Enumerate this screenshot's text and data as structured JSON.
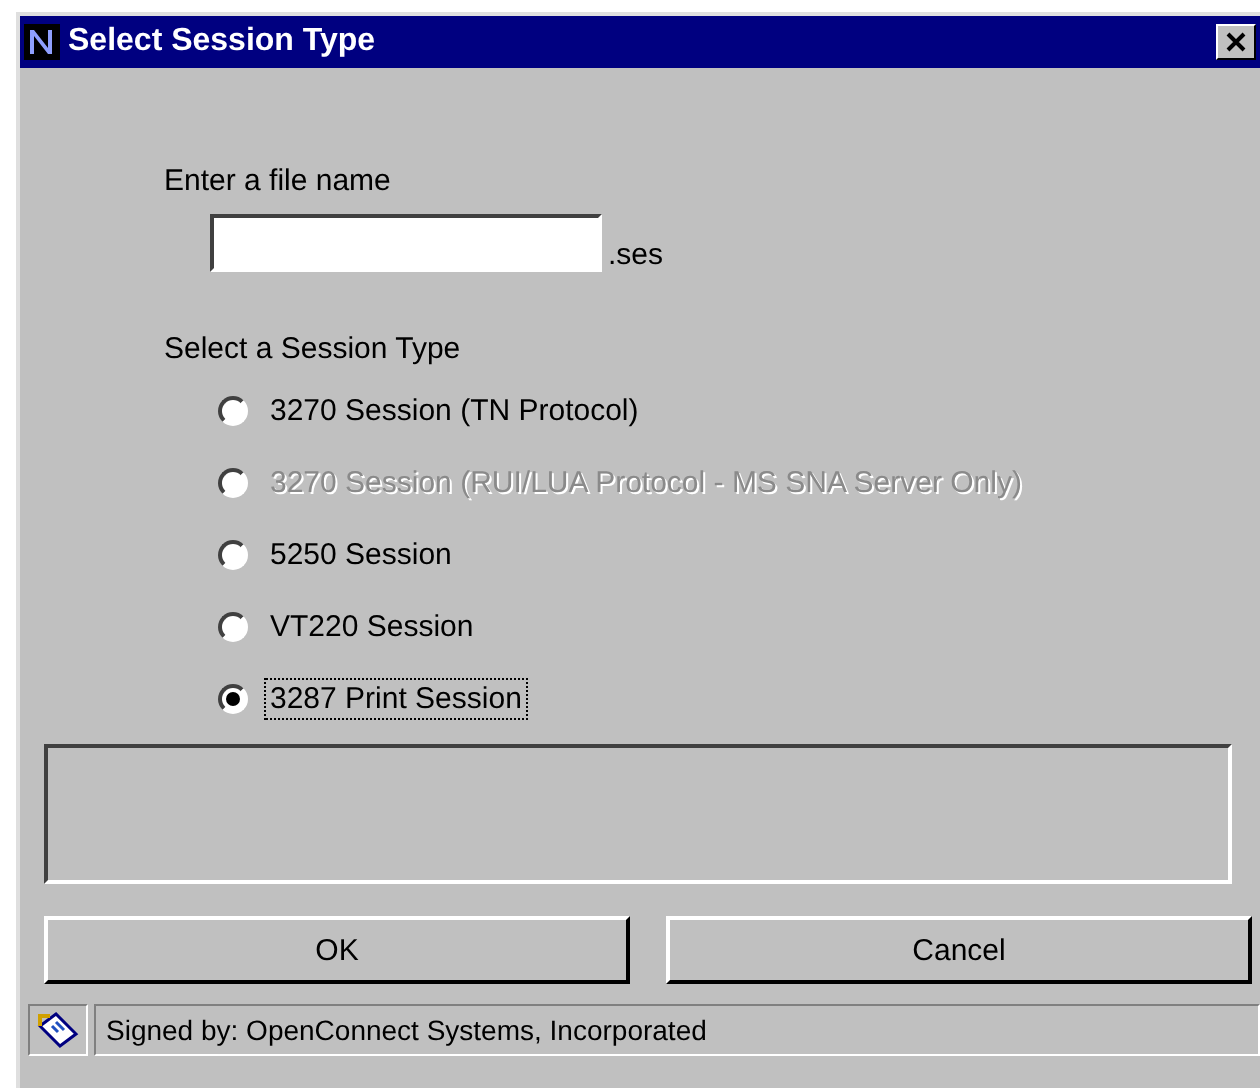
{
  "window": {
    "title": "Select Session Type"
  },
  "file_name": {
    "label": "Enter a file name",
    "suffix": ".ses"
  },
  "session_type": {
    "label": "Select a Session Type",
    "options": [
      {
        "label": "3270 Session (TN Protocol)",
        "selected": false,
        "disabled": false
      },
      {
        "label": "3270 Session (RUI/LUA Protocol - MS SNA Server Only)",
        "selected": false,
        "disabled": true
      },
      {
        "label": "5250 Session",
        "selected": false,
        "disabled": false
      },
      {
        "label": "VT220 Session",
        "selected": false,
        "disabled": false
      },
      {
        "label": "3287 Print Session",
        "selected": true,
        "disabled": false
      }
    ]
  },
  "buttons": [
    "OK",
    "Cancel"
  ],
  "status_bar": {
    "text": "Signed by: OpenConnect Systems, Incorporated"
  }
}
